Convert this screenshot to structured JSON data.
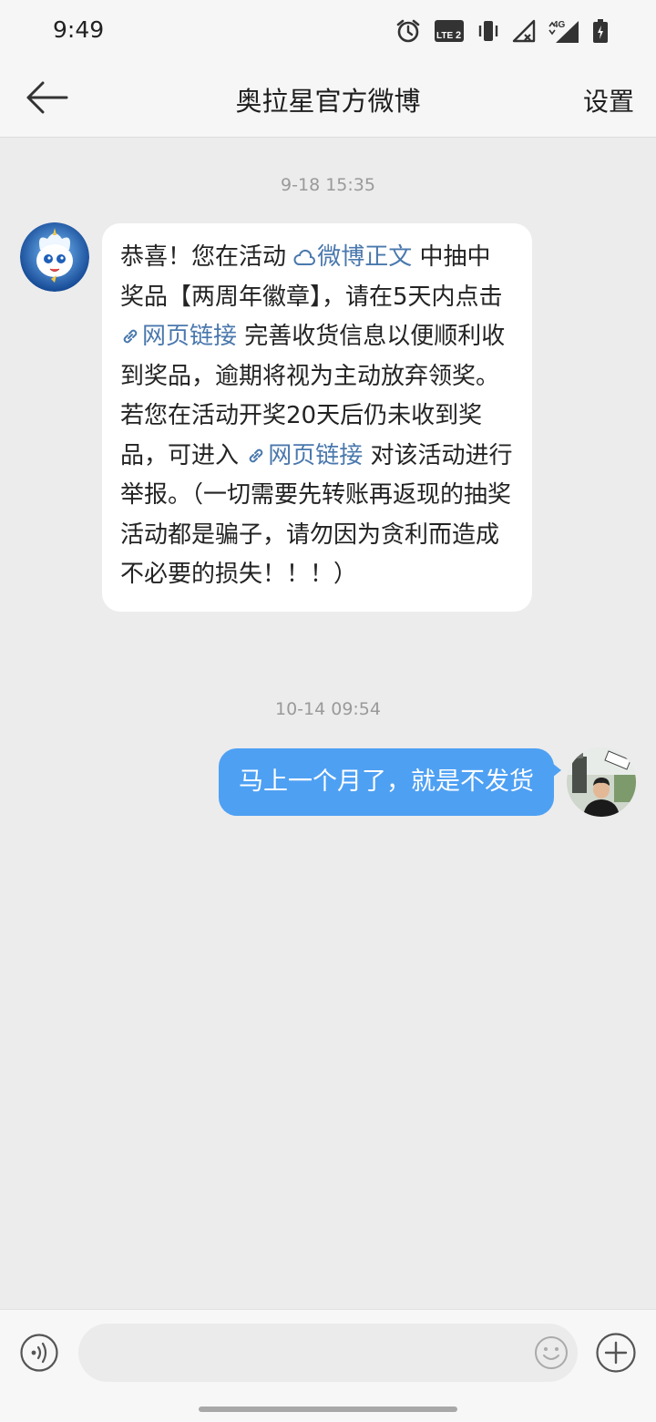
{
  "status_bar": {
    "time": "9:49",
    "icons": [
      "alarm-icon",
      "volte-icon",
      "vibrate-icon",
      "wifi-off-icon",
      "signal-4g-icon",
      "battery-charging-icon"
    ],
    "volte_label": "LTE",
    "volte_sim": "2",
    "network_label": "4G"
  },
  "header": {
    "title": "奥拉星官方微博",
    "settings_label": "设置",
    "back_icon": "arrow-left-icon"
  },
  "messages": [
    {
      "timestamp": "9-18 15:35",
      "direction": "incoming",
      "segments": [
        {
          "type": "text",
          "text": "恭喜！您在活动 "
        },
        {
          "type": "link",
          "icon": "weibo-cloud-icon",
          "text": "微博正文"
        },
        {
          "type": "text",
          "text": " 中抽中奖品【两周年徽章】，请在5天内点击 "
        },
        {
          "type": "link",
          "icon": "link-icon",
          "text": "网页链接"
        },
        {
          "type": "text",
          "text": " 完善收货信息以便顺利收到奖品，逾期将视为主动放弃领奖。若您在活动开奖20天后仍未收到奖品，可进入 "
        },
        {
          "type": "link",
          "icon": "link-icon",
          "text": "网页链接"
        },
        {
          "type": "text",
          "text": " 对该活动进行举报。（一切需要先转账再返现的抽奖活动都是骗子，请勿因为贪利而造成不必要的损失！！！）"
        }
      ]
    },
    {
      "timestamp": "10-14 09:54",
      "direction": "outgoing",
      "text": "马上一个月了，就是不发货"
    }
  ],
  "input_bar": {
    "placeholder": "",
    "value": "",
    "icons": [
      "voice-icon",
      "emoji-icon",
      "plus-icon"
    ]
  },
  "colors": {
    "background": "#ececec",
    "bar": "#f6f6f6",
    "incoming_bubble": "#ffffff",
    "outgoing_bubble": "#4ea0f3",
    "link": "#4a78ad",
    "timestamp": "#9a9a9a"
  }
}
